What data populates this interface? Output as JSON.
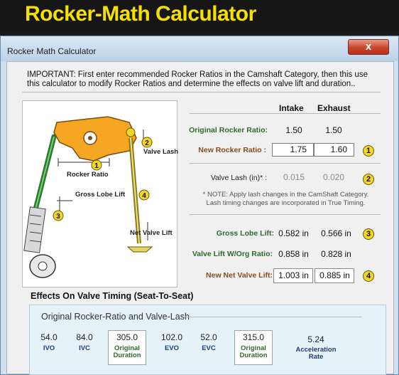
{
  "banner": {
    "title": "Rocker-Math Calculator"
  },
  "window": {
    "title": "Rocker Math Calculator",
    "close_label": "x"
  },
  "important_text": "IMPORTANT: First enter recommended Rocker Ratios in the Camshaft Category, then this use this calculator to modify Rocker Ratios and determine the effects on valve lift and duration..",
  "diagram": {
    "label_valve_lash": "Valve Lash",
    "label_rocker_ratio": "Rocker Ratio",
    "label_gross_lobe_lift": "Gross Lobe Lift",
    "label_net_valve_lift": "Net Valve Lift",
    "badges": [
      "1",
      "2",
      "3",
      "4"
    ]
  },
  "table": {
    "col_intake": "Intake",
    "col_exhaust": "Exhaust",
    "orig_ratio_label": "Original Rocker Ratio:",
    "orig_ratio_intake": "1.50",
    "orig_ratio_exhaust": "1.50",
    "new_ratio_label": "New Rocker Ratio :",
    "new_ratio_intake": "1.75",
    "new_ratio_exhaust": "1.60",
    "new_ratio_badge": "1",
    "lash_label": "Valve Lash (in)* :",
    "lash_intake": "0.015",
    "lash_exhaust": "0.020",
    "lash_badge": "2",
    "note_line1": "* NOTE: Apply lash changes in the CamShaft Category.",
    "note_line2": "Lash timing changes are incorporated in True Timing.",
    "gross_label": "Gross Lobe Lift:",
    "gross_intake": "0.582 in",
    "gross_exhaust": "0.566 in",
    "gross_badge": "3",
    "orgratio_label": "Valve Lift W/Org Ratio:",
    "orgratio_intake": "0.858 in",
    "orgratio_exhaust": "0.828 in",
    "net_label": "New Net Valve Lift:",
    "net_intake": "1.003 in",
    "net_exhaust": "0.885 in",
    "net_badge": "4"
  },
  "effects": {
    "title": "Effects On Valve Timing (Seat-To-Seat)",
    "panel_title": "Original Rocker-Ratio and Valve-Lash",
    "ivo": "54.0",
    "ivo_label": "IVO",
    "ivc": "84.0",
    "ivc_label": "IVC",
    "int_duration": "305.0",
    "duration_label_1": "Original",
    "duration_label_2": "Duration",
    "evo": "102.0",
    "evo_label": "EVO",
    "evc": "52.0",
    "evc_label": "EVC",
    "exh_duration": "315.0",
    "accel": "5.24",
    "accel_label_1": "Acceleration",
    "accel_label_2": "Rate"
  },
  "colors": {
    "banner_text": "#f5e000",
    "label_green": "#2f6a2c",
    "label_brown": "#8a4a1f",
    "badge_yellow": "#f3d52a",
    "panel_blue": "#e6f2fa",
    "close_red": "#c9442c"
  }
}
